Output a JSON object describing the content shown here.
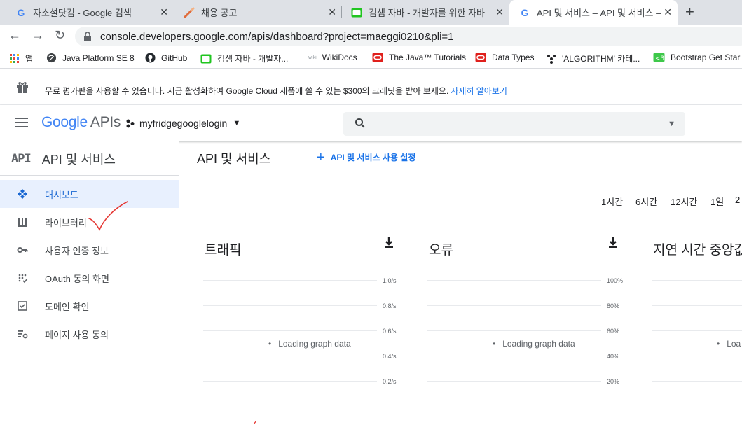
{
  "browser": {
    "tabs": [
      {
        "title": "자소설닷컴 - Google 검색",
        "icon": "google-g-icon"
      },
      {
        "title": "채용 공고",
        "icon": "pen-icon"
      },
      {
        "title": "김샘 자바 - 개발자를 위한 자바",
        "icon": "blog-icon"
      },
      {
        "title": "API 및 서비스 – API 및 서비스 –",
        "icon": "google-g-icon",
        "active": true
      }
    ],
    "new_tab": "+",
    "close_glyph": "✕",
    "url": "console.developers.google.com/apis/dashboard?project=maeggi0210&pli=1",
    "bookmarks": [
      {
        "label": "앱",
        "icon": "apps-grid-icon"
      },
      {
        "label": "Java Platform SE 8",
        "icon": "globe-icon"
      },
      {
        "label": "GitHub",
        "icon": "github-icon"
      },
      {
        "label": "김샘 자바 - 개발자...",
        "icon": "blog-icon"
      },
      {
        "label": "WikiDocs",
        "icon": "wikidocs-icon"
      },
      {
        "label": "The Java™ Tutorials",
        "icon": "oracle-icon"
      },
      {
        "label": "Data Types",
        "icon": "oracle-icon"
      },
      {
        "label": "'ALGORITHM' 카테...",
        "icon": "dots-icon"
      },
      {
        "label": "Bootstrap Get Star",
        "icon": "bootstrap-icon"
      }
    ]
  },
  "promo": {
    "text": "무료 평가판을 사용할 수 있습니다. 지금 활성화하여 Google Cloud 제품에 쓸 수 있는 $300의 크레딧을 받아 보세요.",
    "link": "자세히 알아보기"
  },
  "header": {
    "logo_google": "Google",
    "logo_apis": "APIs",
    "project": "myfridgegooglelogin"
  },
  "sidenav": {
    "badge": "API",
    "title": "API 및 서비스",
    "items": [
      {
        "label": "대시보드",
        "icon": "dashboard-icon",
        "active": true
      },
      {
        "label": "라이브러리",
        "icon": "library-icon"
      },
      {
        "label": "사용자 인증 정보",
        "icon": "key-icon"
      },
      {
        "label": "OAuth 동의 화면",
        "icon": "consent-icon"
      },
      {
        "label": "도메인 확인",
        "icon": "checkbox-icon"
      },
      {
        "label": "페이지 사용 동의",
        "icon": "settings-list-icon"
      }
    ]
  },
  "main": {
    "title": "API 및 서비스",
    "enable_button": "API 및 서비스 사용 설정",
    "time_ranges": [
      "1시간",
      "6시간",
      "12시간",
      "1일",
      "2"
    ],
    "cards": [
      {
        "title": "트래픽",
        "ticks": [
          "1.0/s",
          "0.8/s",
          "0.6/s",
          "0.4/s",
          "0.2/s"
        ],
        "loading": "Loading graph data"
      },
      {
        "title": "오류",
        "ticks": [
          "100%",
          "80%",
          "60%",
          "40%",
          "20%"
        ],
        "loading": "Loading graph data"
      },
      {
        "title": "지연 시간 중앙값",
        "ticks": [],
        "loading": "Loa"
      }
    ]
  },
  "colors": {
    "accent": "#1a73e8",
    "active_bg": "#e8f0fe",
    "annotation": "#e53935"
  }
}
